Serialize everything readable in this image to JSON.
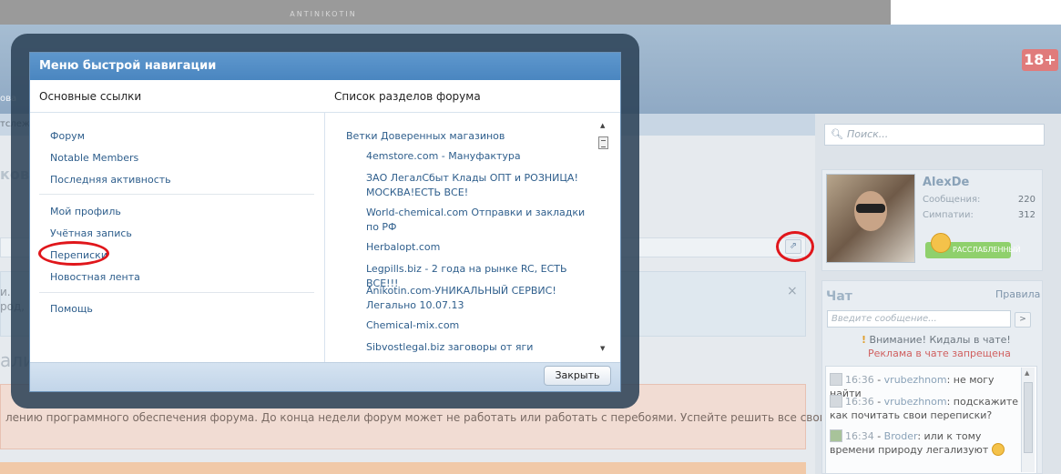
{
  "background": {
    "logo_text": "ANTINIKOTIN",
    "age_badge": "18+",
    "cut_texts": [
      "ковс",
      "ова",
      "тслеж",
      "и.",
      "род, Г",
      "али"
    ],
    "notice_text": "лению программного обеспечения форума. До конца недели форум может не работать или работать с перебоями. Успейте решить все свои",
    "close_x": "×",
    "expand_icon": "⇗"
  },
  "sidebar": {
    "search_placeholder": "Поиск...",
    "user": {
      "name": "AlexDe",
      "messages_label": "Сообщения:",
      "messages_value": "220",
      "likes_label": "Симпатии:",
      "likes_value": "312",
      "mood": "РАССЛАБЛЕННЫЙ"
    },
    "chat": {
      "title": "Чат",
      "rules_link": "Правила",
      "input_placeholder": "Введите сообщение...",
      "send_label": ">",
      "warning": "Внимание! Кидалы в чате!",
      "warning_icon": "!",
      "ad_notice": "Реклама в чате запрещена",
      "messages": [
        {
          "time": "16:36",
          "nick": "vrubezhnom",
          "text": "не могу найти"
        },
        {
          "time": "16:36",
          "nick": "vrubezhnom",
          "text": "подскажите как почитать свои переписки?"
        },
        {
          "time": "16:34",
          "nick": "Broder",
          "text": "или к тому времени природу легализуют"
        }
      ]
    }
  },
  "modal": {
    "title": "Меню быстрой навигации",
    "left_header": "Основные ссылки",
    "right_header": "Список разделов форума",
    "links": {
      "forum": "Форум",
      "notable": "Notable Members",
      "activity": "Последняя активность",
      "profile": "Мой профиль",
      "account": "Учётная запись",
      "conversations": "Переписки",
      "news": "Новостная лента",
      "help": "Помощь"
    },
    "forum_category": "Ветки Доверенных магазинов",
    "forum_items": [
      "4emstore.com - Мануфактура",
      "ЗАО ЛегалСбыт Клады ОПТ и РОЗНИЦА! МОСКВА!ЕСТЬ ВСЕ!",
      "World-chemical.com Отправки и закладки по РФ",
      "Herbalopt.com",
      "Legpills.biz - 2 года на рынке RC, ЕСТЬ ВСЕ!!!",
      "Anikotin.com-УНИКАЛЬНЫЙ СЕРВИС! Легально 10.07.13",
      "Chemical-mix.com",
      "Sibvostlegal.biz заговоры от яги"
    ],
    "close_label": "Закрыть"
  }
}
